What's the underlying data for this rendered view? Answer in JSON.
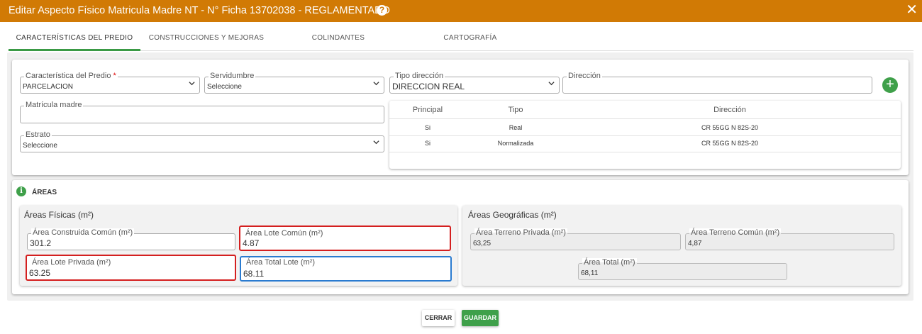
{
  "dialog": {
    "title": "Editar Aspecto Físico Matricula Madre NT - N° Ficha 13702038 - REGLAMENTADO",
    "help_glyph": "?",
    "close_glyph": "✕",
    "accent_color": "#d17a05"
  },
  "tabs": [
    {
      "label": "CARACTERÍSTICAS DEL PREDIO",
      "active": true
    },
    {
      "label": "CONSTRUCCIONES Y MEJORAS",
      "active": false
    },
    {
      "label": "COLINDANTES",
      "active": false
    },
    {
      "label": "CARTOGRAFÍA",
      "active": false
    }
  ],
  "predio": {
    "caracteristica": {
      "label": "Característica del Predio",
      "required_mark": "*",
      "value": "PARCELACION"
    },
    "servidumbre": {
      "label": "Servidumbre",
      "value": "Seleccione"
    },
    "matricula": {
      "label": "Matrícula madre",
      "value": ""
    },
    "estrato": {
      "label": "Estrato",
      "value": "Seleccione"
    },
    "tipo_direccion": {
      "label": "Tipo dirección",
      "value": "DIRECCION REAL"
    },
    "direccion": {
      "label": "Dirección",
      "value": ""
    },
    "add_glyph": "+"
  },
  "direcciones": {
    "headers": [
      "Principal",
      "Tipo",
      "Dirección"
    ],
    "rows": [
      [
        "Si",
        "Real",
        "CR 55GG N 82S-20"
      ],
      [
        "Si",
        "Normalizada",
        "CR 55GG N 82S-20"
      ]
    ]
  },
  "areas": {
    "section_title": "ÁREAS",
    "info_glyph": "i",
    "fisicas": {
      "title": "Áreas Físicas (m²)",
      "construida_comun": {
        "label": "Área Construida Común (m²)",
        "value": "301.2"
      },
      "lote_comun": {
        "label": "Área Lote Común (m²)",
        "value": "4.87"
      },
      "lote_privada": {
        "label": "Área Lote Privada (m²)",
        "value": "63.25"
      },
      "total_lote": {
        "label": "Área Total Lote (m²)",
        "value": "68.11"
      }
    },
    "geograficas": {
      "title": "Áreas Geográficas (m²)",
      "terreno_privada": {
        "label": "Área Terreno Privada (m²)",
        "value": "63,25"
      },
      "terreno_comun": {
        "label": "Área Terreno Común (m²)",
        "value": "4,87"
      },
      "total": {
        "label": "Área Total (m²)",
        "value": "68,11"
      }
    }
  },
  "footer": {
    "cerrar": "CERRAR",
    "guardar": "GUARDAR"
  }
}
